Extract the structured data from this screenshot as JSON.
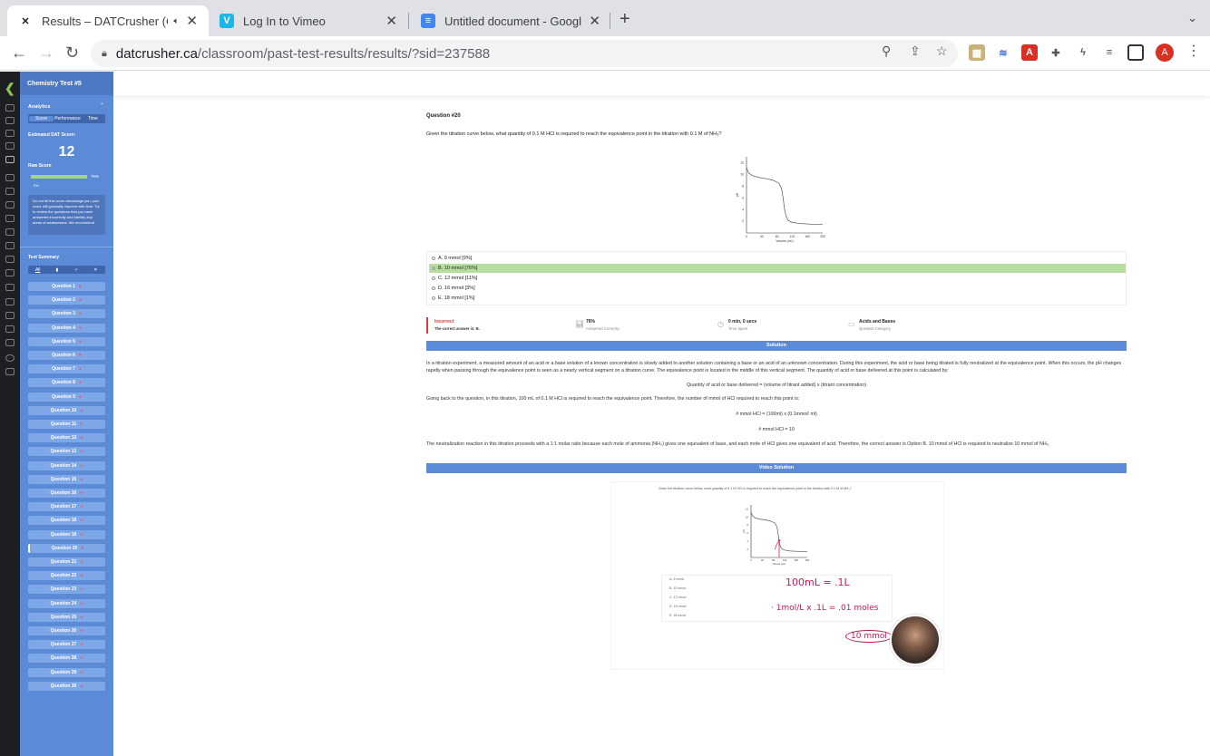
{
  "browser": {
    "tabs": [
      {
        "title": "Results – DATCrusher (Can",
        "favicon": "X",
        "active": true
      },
      {
        "title": "Log In to Vimeo",
        "favicon": "V",
        "active": false
      },
      {
        "title": "Untitled document - Google Do",
        "favicon": "≡",
        "active": false
      }
    ],
    "url_host": "datcrusher.ca",
    "url_path": "/classroom/past-test-results/results/?sid=237588",
    "profile_initial": "A"
  },
  "sidebar": {
    "test_title": "Chemistry Test #5",
    "analytics_label": "Analytics",
    "tabs": [
      "Score",
      "Performance",
      "Time"
    ],
    "estimated_label": "Estimated DAT Score:",
    "estimated_score": "12",
    "raw_label": "Raw Score",
    "raw_pct": "76%",
    "raw_zero": "0%",
    "raw_fraction": 0.76,
    "note": "Do not let this score discourage you, your score will gradually improve with time. Try to review the questions that you have answered incorrectly and identify any areas of weaknesses. We recommend",
    "summary_label": "Test Summary",
    "filters": [
      "All",
      "▮",
      "✓",
      "✕"
    ],
    "questions": [
      "Question 1",
      "Question 2",
      "Question 3",
      "Question 4",
      "Question 5",
      "Question 6",
      "Question 7",
      "Question 8",
      "Question 9",
      "Question 10",
      "Question 11",
      "Question 12",
      "Question 13",
      "Question 14",
      "Question 15",
      "Question 16",
      "Question 17",
      "Question 18",
      "Question 19",
      "Question 20",
      "Question 21",
      "Question 22",
      "Question 23",
      "Question 24",
      "Question 25",
      "Question 26",
      "Question 27",
      "Question 28",
      "Question 29",
      "Question 30"
    ]
  },
  "question": {
    "number": "Question #20",
    "text": "Given the titration curve below, what quantity of 0.1 M HCl is required to reach the equivalence point in the titration with 0.1 M of NH₃?",
    "options": [
      "A. 9 mmol [9%]",
      "B. 10 mmol [76%]",
      "C. 12 mmol [11%]",
      "D. 16 mmol [3%]",
      "E. 18 mmol [1%]"
    ]
  },
  "chart_data": {
    "type": "line",
    "xlabel": "Volume (mL)",
    "ylabel": "pH",
    "x_ticks": [
      "0",
      "40",
      "80",
      "120",
      "160",
      "200"
    ],
    "y_ticks": [
      "2",
      "4",
      "6",
      "8",
      "10",
      "12"
    ],
    "xlim": [
      0,
      200
    ],
    "ylim": [
      0,
      13
    ],
    "series": [
      {
        "x": [
          0,
          5,
          15,
          30,
          50,
          70,
          85,
          92,
          96,
          100,
          104,
          110,
          120,
          140,
          170,
          200
        ],
        "y": [
          11.2,
          10.3,
          9.8,
          9.5,
          9.3,
          9.0,
          8.5,
          7.6,
          6.0,
          4.0,
          2.8,
          2.1,
          1.8,
          1.6,
          1.5,
          1.5
        ]
      }
    ]
  },
  "stats": {
    "result": "Incorrect",
    "correct_answer": "The correct answer is: B.",
    "pct": "76%",
    "pct_sub": "Answered Correctly",
    "time": "0 min, 0 secs",
    "time_sub": "Time Spent",
    "category": "Acids and Bases",
    "category_sub": "Question Category"
  },
  "solution": {
    "header": "Solution",
    "p1": "In a titration experiment, a measured amount of an acid or a base solution of a known concentration is slowly added to another solution containing a base or an acid of an unknown concentration. During this experiment, the acid or base being titrated is fully neutralized at the equivalence point. When this occurs, the pH changes rapidly when passing through the equivalence point is seen as a nearly vertical segment on a titration curve. The equivalence point is located in the middle of this vertical segment. The quantity of acid or base delivered at this point is calculated by:",
    "eq1": "Quantity of acid or base delivered = (volume of titrant added) x (titrant concentration)",
    "p2": "Going back to the question, in this titration, 100 mL of 0.1 M HCl is required to reach the equivalence point. Therefore, the number of mmol of HCl required to reach this point is:",
    "eq2": "# mmol HCl = (100ml) x (0.1mmol/ ml)",
    "eq3": "# mmol HCl = 10",
    "p3": "The neutralization reaction in this titration proceeds with a 1:1 molar ratio because each mole of ammonia (NH₃) gives one equivalent of base, and each mole of HCl gives one equivalent of acid. Therefore, the correct answer is Option B. 10 mmol of HCl is required to neutralize 10 mmol of NH₃."
  },
  "video": {
    "header": "Video Solution",
    "question": "Given the titration curve below, what quantity of 0.1 M HCl is required to reach the equivalence point in the titration with 0.1 M of NH₃?",
    "options": [
      "A. 9 mmol",
      "B. 10 mmol",
      "C. 12 mmol",
      "D. 16 mmol",
      "E. 18 mmol"
    ],
    "handwriting": [
      "100mL = .1L",
      "· 1mol/L x .1L = .01 moles",
      "10 mmol"
    ]
  }
}
